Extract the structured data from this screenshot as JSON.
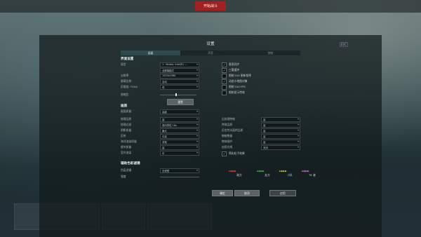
{
  "topbar": {
    "center_button": "开始战斗"
  },
  "dialog": {
    "title": "设置",
    "close_label": "ESC"
  },
  "tabs": [
    {
      "label": "画面",
      "active": true
    },
    {
      "label": "声音",
      "active": false
    },
    {
      "label": "控制",
      "active": false
    }
  ],
  "sections": {
    "interface": "界面设置",
    "graphics": "画质",
    "color_filter": "辅助色彩滤镜"
  },
  "interface_left": [
    {
      "label": "语言",
      "value": "1 - Nvidia, Intel(R) ..."
    },
    {
      "label": "",
      "value": "全屏幕模式"
    },
    {
      "label": "分辨率",
      "value": "1920x1080"
    },
    {
      "label": "屏幕比例",
      "value": "自动"
    },
    {
      "label": "反锯齿: FXAA",
      "value": "低"
    },
    {
      "label": "放缩比",
      "value": ""
    }
  ],
  "interface_right": [
    {
      "label": "垂直同步",
      "checked": true
    },
    {
      "label": "三重缓冲",
      "checked": true
    },
    {
      "label": "限制 GUI 更新频率",
      "checked": false
    },
    {
      "label": "动态小地图对象",
      "checked": true
    },
    {
      "label": "限制 GUI FPS",
      "checked": false
    },
    {
      "label": "限制显示特效",
      "checked": false
    }
  ],
  "reset_button": "重置",
  "graphics_main": {
    "label": "画面质量",
    "value": "高级"
  },
  "graphics_left": [
    {
      "label": "纹理品质",
      "value": "高"
    },
    {
      "label": "纹理过滤",
      "value": "各向异性 16x"
    },
    {
      "label": "阴影质量",
      "value": "最大"
    },
    {
      "label": "反射",
      "value": "中高"
    },
    {
      "label": "海洋渲染质量",
      "value": "非常"
    },
    {
      "label": "细节质量",
      "value": "高"
    },
    {
      "label": "室内渲染",
      "value": "中"
    }
  ],
  "graphics_right": [
    {
      "label": "后处理特效",
      "value": "高"
    },
    {
      "label": "特效品质",
      "value": "高"
    },
    {
      "label": "反应性水面的品质",
      "value": "高"
    },
    {
      "label": "植被数量",
      "value": "高"
    },
    {
      "label": "物体细节",
      "value": "高"
    },
    {
      "label": "启用光线",
      "value": "关闭"
    }
  ],
  "particles_checkbox": {
    "label": "简化粒子效果",
    "checked": true
  },
  "color_filter": {
    "label": "色盲滤镜",
    "value": "无滤镜",
    "strength_label": "强度"
  },
  "color_legend": [
    {
      "label": "敌方",
      "color": "#e04848"
    },
    {
      "label": "友方",
      "color": "#48c848"
    },
    {
      "label": "小队",
      "color": "#e0c840"
    },
    {
      "label": "TK 者",
      "color": "#e070e0"
    }
  ],
  "footer": {
    "ok": "确定",
    "cancel": "取消",
    "apply": "应用"
  }
}
